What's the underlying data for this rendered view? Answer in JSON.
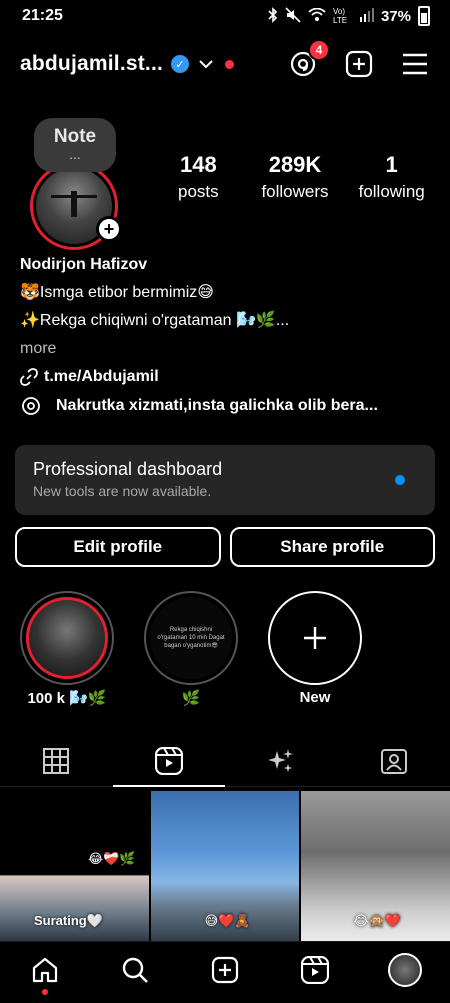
{
  "status_bar": {
    "time": "21:25",
    "network": "Vo) LTE",
    "battery": "37%"
  },
  "header": {
    "username": "abdujamil.st...",
    "threads_badge": "4"
  },
  "note": {
    "title": "Note",
    "dots": "..."
  },
  "stats": [
    {
      "value": "148",
      "label": "posts"
    },
    {
      "value": "289K",
      "label": "followers"
    },
    {
      "value": "1",
      "label": "following"
    }
  ],
  "bio": {
    "name": "Nodirjon Hafizov",
    "line1": "🐯Ismga etibor bermimiz😅",
    "line2": "✨Rekga chiqiwni o'rgataman 🌬️🌿...",
    "more": "more",
    "link": "t.me/Abdujamil"
  },
  "threads_text": "Nakrutka xizmati,insta galichka olib bera...",
  "dashboard": {
    "title": "Professional dashboard",
    "subtitle": "New tools are now available."
  },
  "buttons": {
    "edit": "Edit profile",
    "share": "Share profile"
  },
  "highlights": [
    {
      "label": "100 k 🌬️🌿"
    },
    {
      "label": "🌿",
      "inner_text": "Rekga chiqishni o'rgataman 10 min Dagat bagan o'yganotim😎"
    },
    {
      "label": "New"
    }
  ],
  "grid": [
    {
      "caption_top": "😂❤️‍🩹🌿",
      "caption_bottom": "Surating🤍"
    },
    {
      "caption": "😅❤️🧸"
    },
    {
      "caption": "😂🙊❤️"
    }
  ],
  "colors": {
    "accent_red": "#ff3040",
    "blue": "#0095f6",
    "verified": "#3897f0",
    "card": "#262626"
  }
}
